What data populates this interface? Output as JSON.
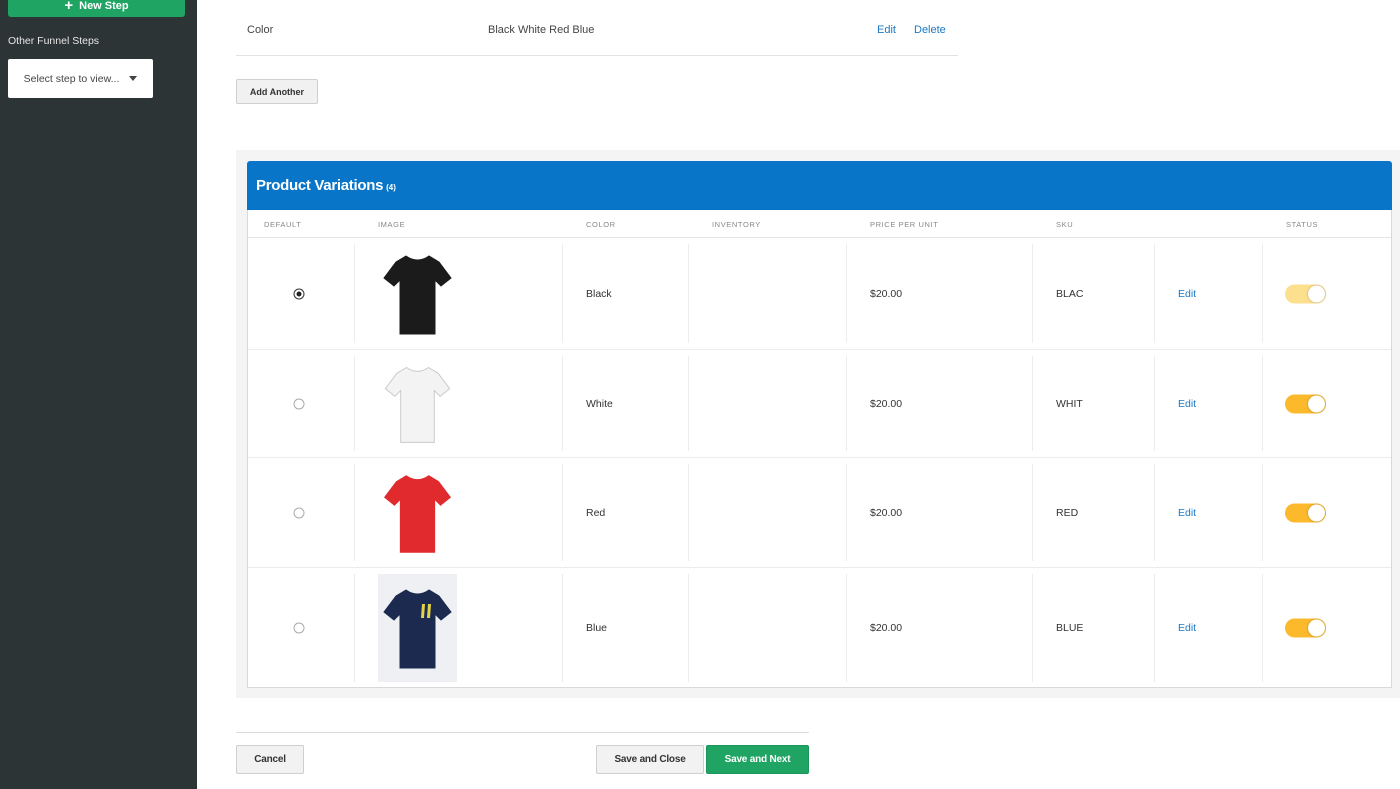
{
  "sidebar": {
    "new_step_label": "New Step",
    "other_steps_label": "Other Funnel Steps",
    "select_placeholder": "Select step to view..."
  },
  "option": {
    "name": "Color",
    "values": "Black White Red Blue",
    "edit_label": "Edit",
    "delete_label": "Delete"
  },
  "add_another_label": "Add Another",
  "variations": {
    "title": "Product Variations",
    "count": "(4)",
    "columns": [
      "DEFAULT",
      "IMAGE",
      "COLOR",
      "INVENTORY",
      "PRICE PER UNIT",
      "SKU",
      "STATUS"
    ],
    "rows": [
      {
        "default": true,
        "image_icon": "black-tshirt-image",
        "color": "Black",
        "inventory": "",
        "price": "$20.00",
        "sku": "BLAC",
        "edit_label": "Edit",
        "status_on": true,
        "status_color": "#fce08e"
      },
      {
        "default": false,
        "image_icon": "white-tshirt-image",
        "color": "White",
        "inventory": "",
        "price": "$20.00",
        "sku": "WHIT",
        "edit_label": "Edit",
        "status_on": true,
        "status_color": "#fbb92b"
      },
      {
        "default": false,
        "image_icon": "red-tshirt-image",
        "color": "Red",
        "inventory": "",
        "price": "$20.00",
        "sku": "RED",
        "edit_label": "Edit",
        "status_on": true,
        "status_color": "#fbb92b"
      },
      {
        "default": false,
        "image_icon": "blue-jersey-image",
        "color": "Blue",
        "inventory": "",
        "price": "$20.00",
        "sku": "BLUE",
        "edit_label": "Edit",
        "status_on": true,
        "status_color": "#fbb92b"
      }
    ]
  },
  "footer": {
    "cancel_label": "Cancel",
    "save_close_label": "Save and Close",
    "save_next_label": "Save and Next"
  },
  "colors": {
    "sidebar_bg": "#2d3436",
    "accent_green": "#1fa463",
    "header_blue": "#0975c9",
    "link_blue": "#1a79c7"
  }
}
